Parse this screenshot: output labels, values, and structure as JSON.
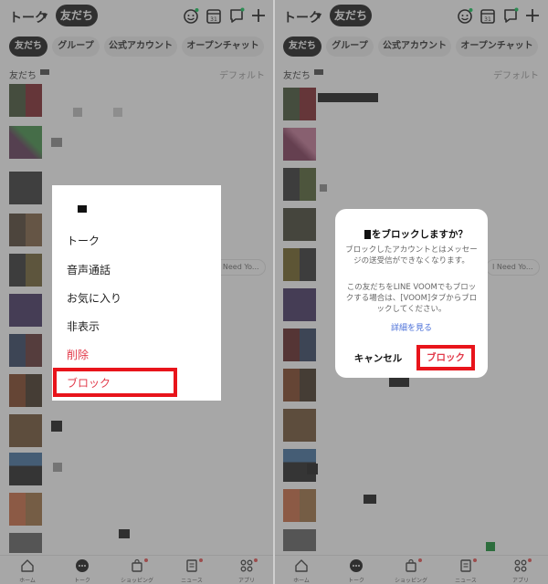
{
  "header": {
    "title": "トーク",
    "friends_pill": "友だち",
    "calendar_number": "31"
  },
  "filters": [
    "友だち",
    "グループ",
    "公式アカウント",
    "オープンチャット"
  ],
  "section": {
    "label": "友だち",
    "sort": "デフォルト"
  },
  "list_preview_snippet": "I Need Yo...",
  "bottom_nav": [
    "ホーム",
    "トーク",
    "ショッピング",
    "ニュース",
    "アプリ"
  ],
  "context_menu": {
    "items": [
      "トーク",
      "音声通話",
      "お気に入り",
      "非表示",
      "削除",
      "ブロック"
    ]
  },
  "dialog": {
    "title": "をブロックしますか？",
    "body1": "ブロックしたアカウントとはメッセージの送受信ができなくなります。",
    "body2": "この友だちをLINE VOOMでもブロックする場合は、[VOOM]タブからブロックしてください。",
    "link": "詳細を見る",
    "cancel": "キャンセル",
    "confirm": "ブロック"
  },
  "colors": {
    "accent_red": "#e8141b",
    "danger_text": "#e23a4a",
    "link_blue": "#4a6fd8",
    "active_chip": "#111111"
  }
}
